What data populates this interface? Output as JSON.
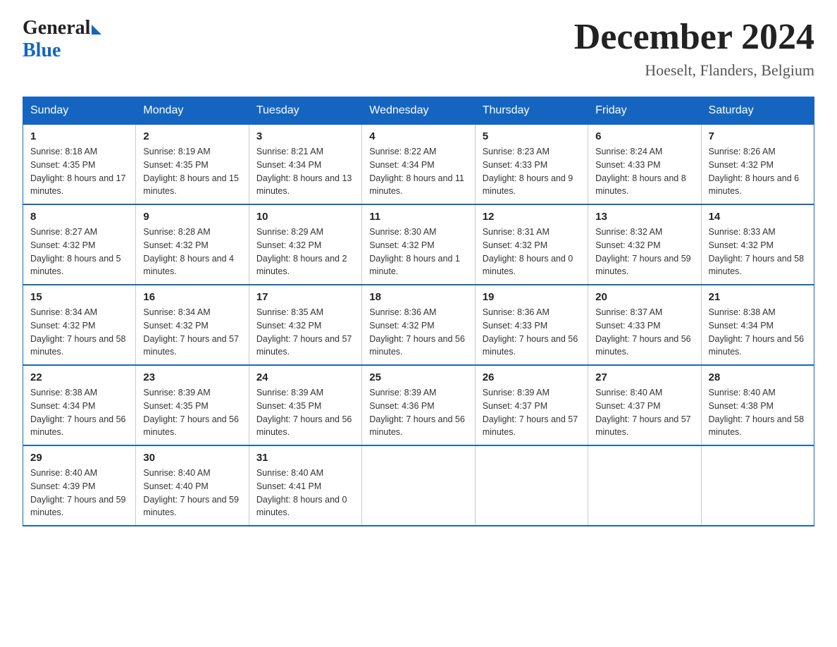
{
  "logo": {
    "general": "General",
    "blue": "Blue"
  },
  "header": {
    "month": "December 2024",
    "location": "Hoeselt, Flanders, Belgium"
  },
  "days_of_week": [
    "Sunday",
    "Monday",
    "Tuesday",
    "Wednesday",
    "Thursday",
    "Friday",
    "Saturday"
  ],
  "weeks": [
    [
      {
        "day": "1",
        "sunrise": "8:18 AM",
        "sunset": "4:35 PM",
        "daylight": "8 hours and 17 minutes."
      },
      {
        "day": "2",
        "sunrise": "8:19 AM",
        "sunset": "4:35 PM",
        "daylight": "8 hours and 15 minutes."
      },
      {
        "day": "3",
        "sunrise": "8:21 AM",
        "sunset": "4:34 PM",
        "daylight": "8 hours and 13 minutes."
      },
      {
        "day": "4",
        "sunrise": "8:22 AM",
        "sunset": "4:34 PM",
        "daylight": "8 hours and 11 minutes."
      },
      {
        "day": "5",
        "sunrise": "8:23 AM",
        "sunset": "4:33 PM",
        "daylight": "8 hours and 9 minutes."
      },
      {
        "day": "6",
        "sunrise": "8:24 AM",
        "sunset": "4:33 PM",
        "daylight": "8 hours and 8 minutes."
      },
      {
        "day": "7",
        "sunrise": "8:26 AM",
        "sunset": "4:32 PM",
        "daylight": "8 hours and 6 minutes."
      }
    ],
    [
      {
        "day": "8",
        "sunrise": "8:27 AM",
        "sunset": "4:32 PM",
        "daylight": "8 hours and 5 minutes."
      },
      {
        "day": "9",
        "sunrise": "8:28 AM",
        "sunset": "4:32 PM",
        "daylight": "8 hours and 4 minutes."
      },
      {
        "day": "10",
        "sunrise": "8:29 AM",
        "sunset": "4:32 PM",
        "daylight": "8 hours and 2 minutes."
      },
      {
        "day": "11",
        "sunrise": "8:30 AM",
        "sunset": "4:32 PM",
        "daylight": "8 hours and 1 minute."
      },
      {
        "day": "12",
        "sunrise": "8:31 AM",
        "sunset": "4:32 PM",
        "daylight": "8 hours and 0 minutes."
      },
      {
        "day": "13",
        "sunrise": "8:32 AM",
        "sunset": "4:32 PM",
        "daylight": "7 hours and 59 minutes."
      },
      {
        "day": "14",
        "sunrise": "8:33 AM",
        "sunset": "4:32 PM",
        "daylight": "7 hours and 58 minutes."
      }
    ],
    [
      {
        "day": "15",
        "sunrise": "8:34 AM",
        "sunset": "4:32 PM",
        "daylight": "7 hours and 58 minutes."
      },
      {
        "day": "16",
        "sunrise": "8:34 AM",
        "sunset": "4:32 PM",
        "daylight": "7 hours and 57 minutes."
      },
      {
        "day": "17",
        "sunrise": "8:35 AM",
        "sunset": "4:32 PM",
        "daylight": "7 hours and 57 minutes."
      },
      {
        "day": "18",
        "sunrise": "8:36 AM",
        "sunset": "4:32 PM",
        "daylight": "7 hours and 56 minutes."
      },
      {
        "day": "19",
        "sunrise": "8:36 AM",
        "sunset": "4:33 PM",
        "daylight": "7 hours and 56 minutes."
      },
      {
        "day": "20",
        "sunrise": "8:37 AM",
        "sunset": "4:33 PM",
        "daylight": "7 hours and 56 minutes."
      },
      {
        "day": "21",
        "sunrise": "8:38 AM",
        "sunset": "4:34 PM",
        "daylight": "7 hours and 56 minutes."
      }
    ],
    [
      {
        "day": "22",
        "sunrise": "8:38 AM",
        "sunset": "4:34 PM",
        "daylight": "7 hours and 56 minutes."
      },
      {
        "day": "23",
        "sunrise": "8:39 AM",
        "sunset": "4:35 PM",
        "daylight": "7 hours and 56 minutes."
      },
      {
        "day": "24",
        "sunrise": "8:39 AM",
        "sunset": "4:35 PM",
        "daylight": "7 hours and 56 minutes."
      },
      {
        "day": "25",
        "sunrise": "8:39 AM",
        "sunset": "4:36 PM",
        "daylight": "7 hours and 56 minutes."
      },
      {
        "day": "26",
        "sunrise": "8:39 AM",
        "sunset": "4:37 PM",
        "daylight": "7 hours and 57 minutes."
      },
      {
        "day": "27",
        "sunrise": "8:40 AM",
        "sunset": "4:37 PM",
        "daylight": "7 hours and 57 minutes."
      },
      {
        "day": "28",
        "sunrise": "8:40 AM",
        "sunset": "4:38 PM",
        "daylight": "7 hours and 58 minutes."
      }
    ],
    [
      {
        "day": "29",
        "sunrise": "8:40 AM",
        "sunset": "4:39 PM",
        "daylight": "7 hours and 59 minutes."
      },
      {
        "day": "30",
        "sunrise": "8:40 AM",
        "sunset": "4:40 PM",
        "daylight": "7 hours and 59 minutes."
      },
      {
        "day": "31",
        "sunrise": "8:40 AM",
        "sunset": "4:41 PM",
        "daylight": "8 hours and 0 minutes."
      },
      null,
      null,
      null,
      null
    ]
  ],
  "labels": {
    "sunrise": "Sunrise:",
    "sunset": "Sunset:",
    "daylight": "Daylight:"
  }
}
